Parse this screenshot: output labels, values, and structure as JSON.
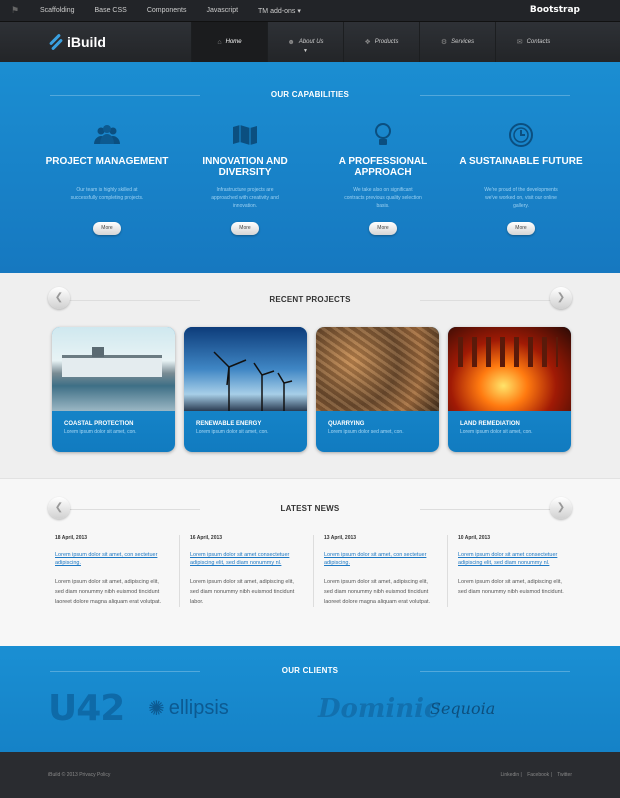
{
  "topbar": {
    "links": [
      "Scaffolding",
      "Base CSS",
      "Components",
      "Javascript",
      "TM add-ons"
    ],
    "brand": "Bootstrap"
  },
  "header": {
    "logo": "iBuild",
    "nav": [
      "Home",
      "About Us",
      "Products",
      "Services",
      "Contacts"
    ]
  },
  "capabilities": {
    "title": "OUR CAPABILITIES",
    "items": [
      {
        "title": "PROJECT MANAGEMENT",
        "text": "Our team is highly skilled at successfully completing projects.",
        "btn": "More",
        "icon": "people-icon"
      },
      {
        "title": "INNOVATION AND DIVERSITY",
        "text": "Infrastructure projects are approached with creativity and innovation.",
        "btn": "More",
        "icon": "map-icon"
      },
      {
        "title": "A PROFESSIONAL APPROACH",
        "text": "We take also on significant contracts previous quality selection basis.",
        "btn": "More",
        "icon": "lightbulb-icon"
      },
      {
        "title": "A SUSTAINABLE FUTURE",
        "text": "We're proud of the developments we've worked on, visit our online gallery.",
        "btn": "More",
        "icon": "clock-icon"
      }
    ]
  },
  "projects": {
    "title": "RECENT PROJECTS",
    "items": [
      {
        "title": "COASTAL PROTECTION",
        "text": "Lorem ipsum dolor sit amet, con."
      },
      {
        "title": "RENEWABLE ENERGY",
        "text": "Lorem ipsum dolor sit amet, con."
      },
      {
        "title": "QUARRYING",
        "text": "Lorem ipsum dolor sed amet, con."
      },
      {
        "title": "LAND REMEDIATION",
        "text": "Lorem ipsum dolor sit amet, con."
      }
    ]
  },
  "news": {
    "title": "LATEST NEWS",
    "items": [
      {
        "date": "18 April, 2013",
        "link": "Lorem ipsum dolor sit amet, con sectetuer adipiscing.",
        "text": "Lorem ipsum dolor sit amet, adipiscing elit, sed diam nonummy nibh euismod tincidunt laoreet dolore magna aliquam erat volutpat."
      },
      {
        "date": "16 April, 2013",
        "link": "Lorem ipsum dolor sit amet consectetuer adipiscing elit, sed diam nonummy nl.",
        "text": "Lorem ipsum dolor sit amet, adipiscing elit, sed diam nonummy nibh euismod tincidunt labor."
      },
      {
        "date": "13 April, 2013",
        "link": "Lorem ipsum dolor sit amet, con sectetuer adipiscing.",
        "text": "Lorem ipsum dolor sit amet, adipiscing elit, sed diam nonummy nibh euismod tincidunt laoreet dolore magna aliquam erat volutpat."
      },
      {
        "date": "10 April, 2013",
        "link": "Lorem ipsum dolor sit amet consectetuer adipiscing elit, sed diam nonummy nl.",
        "text": "Lorem ipsum dolor sit amet, adipiscing elit, sed diam nonummy nibh euismod tincidunt."
      }
    ]
  },
  "clients": {
    "title": "OUR CLIENTS",
    "logos": [
      "U42",
      "ellipsis",
      "Dominic",
      "Sequoia"
    ]
  },
  "footer": {
    "copy": "iBuild © 2013 Privacy Policy",
    "links": [
      "Linkedin",
      "Facebook",
      "Twitter"
    ]
  }
}
